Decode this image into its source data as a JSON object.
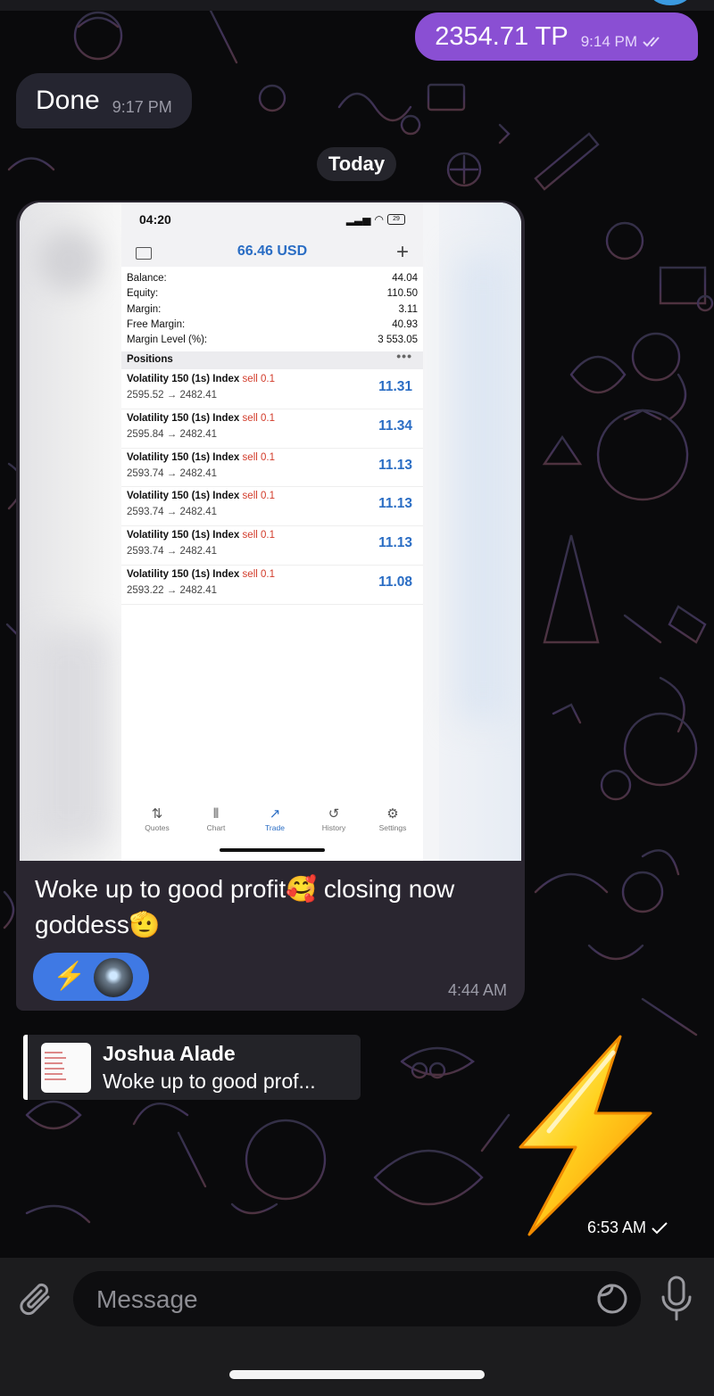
{
  "colors": {
    "outgoing_bubble": "#8a4fd3",
    "incoming_bubble": "#252530",
    "profit_blue": "#2a6dc4",
    "sell_red": "#d23b2a",
    "reaction_blue": "#3f79e4"
  },
  "messages": {
    "outgoing_top": {
      "text": "2354.71 TP",
      "time": "9:14 PM",
      "status_icon": "double-check-icon"
    },
    "incoming_done": {
      "text": "Done",
      "time": "9:17 PM"
    }
  },
  "date_separator": "Today",
  "photo_message": {
    "screenshot": {
      "status_time": "04:20",
      "battery": "29",
      "balance_header": "66.46 USD",
      "account": [
        {
          "label": "Balance:",
          "value": "44.04"
        },
        {
          "label": "Equity:",
          "value": "110.50"
        },
        {
          "label": "Margin:",
          "value": "3.11"
        },
        {
          "label": "Free Margin:",
          "value": "40.93"
        },
        {
          "label": "Margin Level (%):",
          "value": "3 553.05"
        }
      ],
      "positions_label": "Positions",
      "positions": [
        {
          "symbol": "Volatility 150 (1s) Index",
          "side": "sell 0.1",
          "prices": "2595.52 → 2482.41",
          "profit": "11.31"
        },
        {
          "symbol": "Volatility 150 (1s) Index",
          "side": "sell 0.1",
          "prices": "2595.84 → 2482.41",
          "profit": "11.34"
        },
        {
          "symbol": "Volatility 150 (1s) Index",
          "side": "sell 0.1",
          "prices": "2593.74 → 2482.41",
          "profit": "11.13"
        },
        {
          "symbol": "Volatility 150 (1s) Index",
          "side": "sell 0.1",
          "prices": "2593.74 → 2482.41",
          "profit": "11.13"
        },
        {
          "symbol": "Volatility 150 (1s) Index",
          "side": "sell 0.1",
          "prices": "2593.74 → 2482.41",
          "profit": "11.13"
        },
        {
          "symbol": "Volatility 150 (1s) Index",
          "side": "sell 0.1",
          "prices": "2593.22 → 2482.41",
          "profit": "11.08"
        }
      ],
      "nav": [
        {
          "label": "Quotes",
          "icon": "quotes-icon"
        },
        {
          "label": "Chart",
          "icon": "chart-icon"
        },
        {
          "label": "Trade",
          "icon": "trade-icon",
          "active": true
        },
        {
          "label": "History",
          "icon": "history-icon"
        },
        {
          "label": "Settings",
          "icon": "settings-icon"
        }
      ]
    },
    "caption": "Woke up to good profit🥰 closing now goddess🫡",
    "reaction_emoji": "⚡",
    "time": "4:44 AM"
  },
  "reply_preview": {
    "name": "Joshua Alade",
    "text": "Woke up to good prof..."
  },
  "sticker": {
    "emoji": "lightning-bolt-icon",
    "time": "6:53 AM",
    "status_icon": "single-check-icon"
  },
  "composer": {
    "placeholder": "Message"
  }
}
